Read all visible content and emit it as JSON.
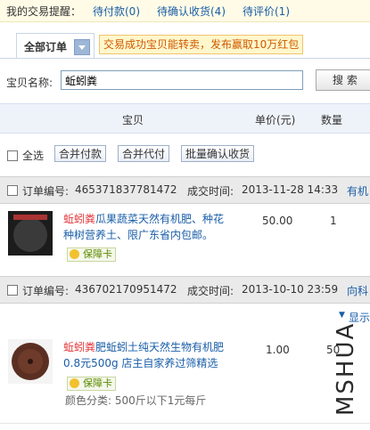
{
  "reminders": {
    "title": "我的交易提醒：",
    "items": [
      "待付款(0)",
      "待确认收货(4)",
      "待评价(1)"
    ]
  },
  "tabs": {
    "all_orders": "全部订单"
  },
  "promo": "交易成功宝贝能转卖，发布赢取10万红包",
  "search": {
    "label": "宝贝名称:",
    "value": "蚯蚓粪",
    "button": "搜 索"
  },
  "table_header": {
    "item": "宝贝",
    "price": "单价(元)",
    "qty": "数量"
  },
  "actions": {
    "select_all": "全选",
    "merge_pay": "合并付款",
    "merge_proxy": "合并代付",
    "batch_confirm": "批量确认收货"
  },
  "orders": [
    {
      "order_label": "订单编号:",
      "order_no": "465371837781472",
      "time_label": "成交时间:",
      "time": "2013-11-28 14:33",
      "seller": "有机",
      "title_kw": "蚯蚓粪",
      "title_rest": "瓜果蔬菜天然有机肥、种花种树营养土、限广东省内包邮。",
      "price": "50.00",
      "qty": "1",
      "badge": "保障卡"
    },
    {
      "order_label": "订单编号:",
      "order_no": "436702170951472",
      "time_label": "成交时间:",
      "time": "2013-10-10 23:59",
      "seller": "向科",
      "show_more": "显示",
      "title_kw": "蚯蚓粪",
      "title_rest": "肥蚯蚓土纯天然生物有机肥0.8元500g 店主自家养过筛精选",
      "price": "1.00",
      "qty": "50",
      "badge": "保障卡",
      "color_label": "颜色分类: 500斤以下1元每斤"
    }
  ],
  "watermark": "MSHUA",
  "colors": {
    "link": "#1a5ea8",
    "keyword": "#e4393c",
    "promo_text": "#d05a00"
  }
}
